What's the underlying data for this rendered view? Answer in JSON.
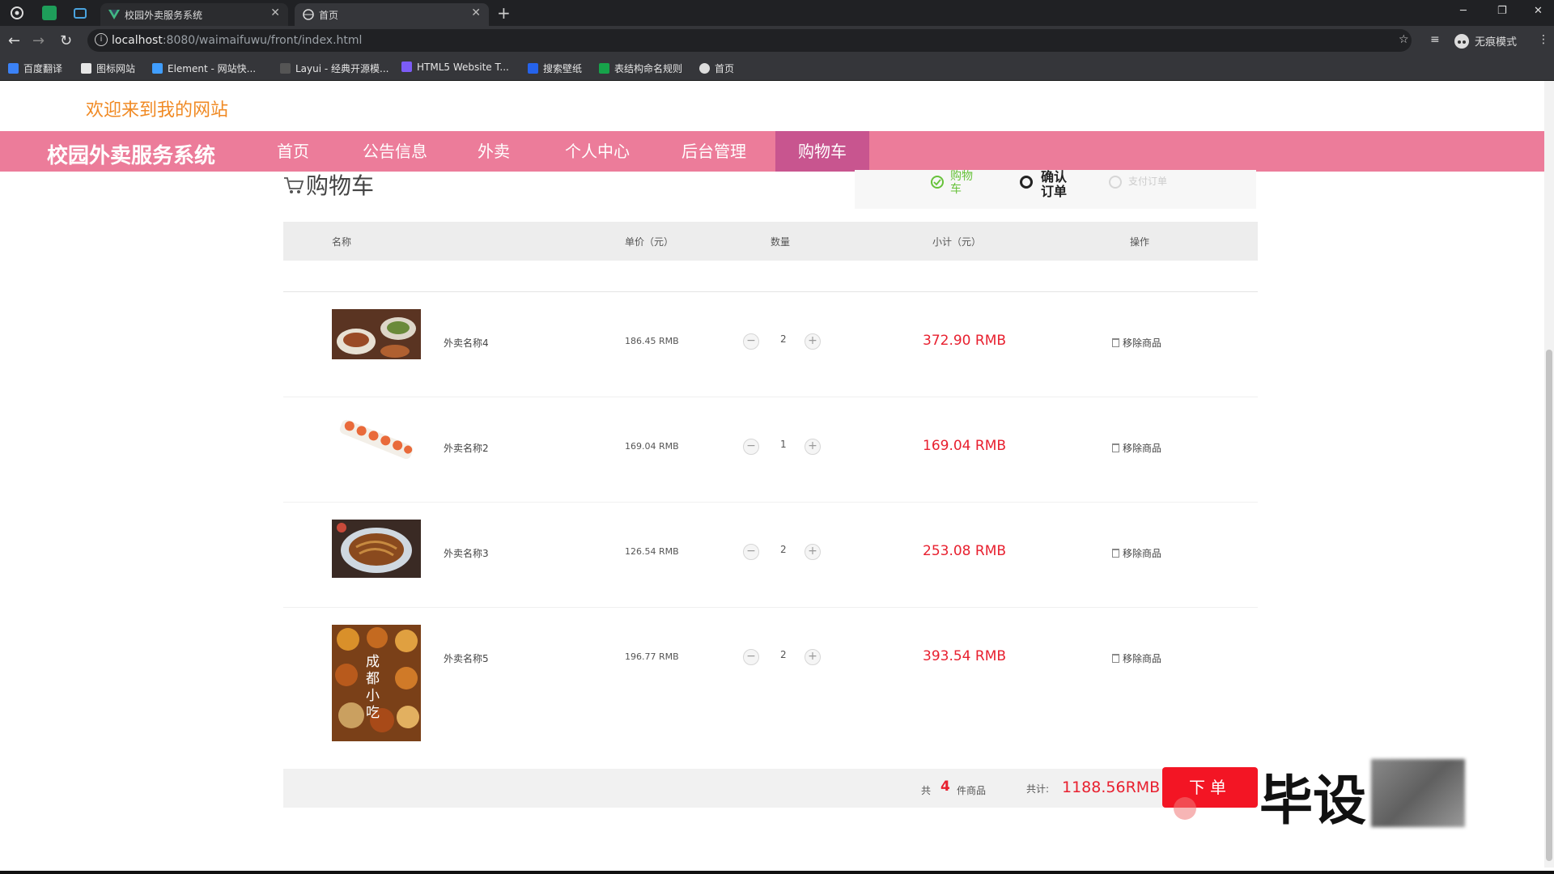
{
  "browser": {
    "tabs": [
      {
        "title": "校园外卖服务系统",
        "active": false
      },
      {
        "title": "首页",
        "active": true
      }
    ],
    "url_host": "localhost",
    "url_rest": ":8080/waimaifuwu/front/index.html",
    "profile_label": "无痕模式",
    "bookmarks": [
      "百度翻译",
      "图标网站",
      "Element - 网站快...",
      "Layui - 经典开源模...",
      "HTML5 Website T...",
      "搜索壁纸",
      "表结构命名规则",
      "首页"
    ]
  },
  "header": {
    "welcome": "欢迎来到我的网站",
    "brand": "校园外卖服务系统",
    "nav": [
      "首页",
      "公告信息",
      "外卖",
      "个人中心",
      "后台管理",
      "购物车"
    ],
    "active_nav": "购物车"
  },
  "cart": {
    "title": "购物车",
    "steps": [
      {
        "label": "购物车",
        "state": "done"
      },
      {
        "label": "确认订单",
        "state": "current"
      },
      {
        "label": "支付订单",
        "state": "pending"
      }
    ],
    "columns": [
      "名称",
      "单价（元）",
      "数量",
      "小计（元）",
      "操作"
    ],
    "items": [
      {
        "name": "外卖名称4",
        "price": "186.45 RMB",
        "qty": "2",
        "subtotal": "372.90 RMB",
        "action": "移除商品"
      },
      {
        "name": "外卖名称2",
        "price": "169.04 RMB",
        "qty": "1",
        "subtotal": "169.04 RMB",
        "action": "移除商品"
      },
      {
        "name": "外卖名称3",
        "price": "126.54 RMB",
        "qty": "2",
        "subtotal": "253.08 RMB",
        "action": "移除商品"
      },
      {
        "name": "外卖名称5",
        "price": "196.77 RMB",
        "qty": "2",
        "subtotal": "393.54 RMB",
        "action": "移除商品"
      }
    ],
    "summary": {
      "prefix": "共",
      "count": "4",
      "suffix": "件商品",
      "total_label": "共计:",
      "total": "1188.56RMB",
      "order_button": "下单"
    },
    "thumb_text": "成都小吃"
  },
  "overlay": {
    "watermark": "毕设"
  },
  "colors": {
    "nav_bg": "#ec7c9a",
    "nav_active": "#c8558f",
    "welcome": "#f08a24",
    "price_red": "#e8202f",
    "order_btn": "#f31524",
    "step_done": "#67c23a"
  }
}
